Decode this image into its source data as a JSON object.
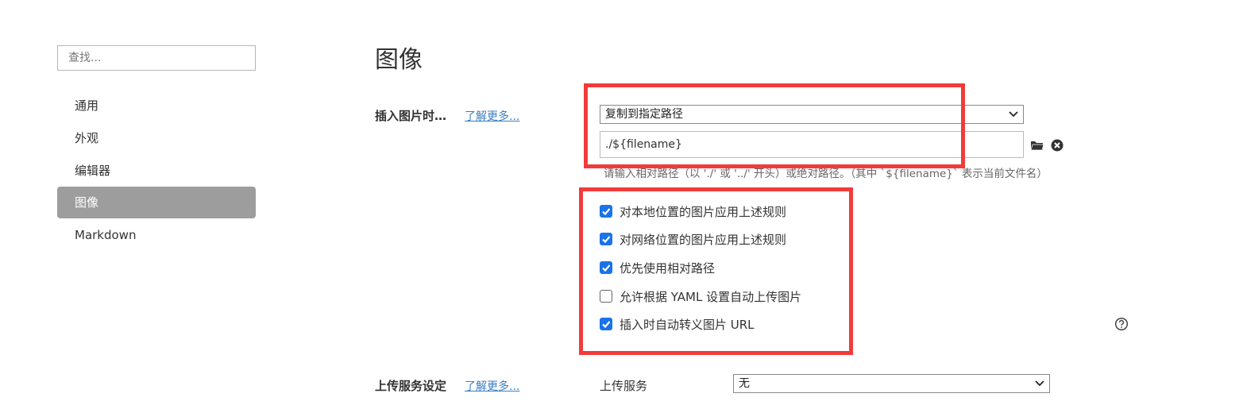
{
  "sidebar": {
    "search_placeholder": "查找...",
    "items": [
      {
        "label": "通用"
      },
      {
        "label": "外观"
      },
      {
        "label": "编辑器"
      },
      {
        "label": "图像",
        "active": true
      },
      {
        "label": "Markdown"
      }
    ]
  },
  "main": {
    "title": "图像",
    "insert_section": {
      "label": "插入图片时…",
      "learn_more": "了解更多...",
      "action_select": "复制到指定路径",
      "path_value": "./${filename}",
      "hint": "请输入相对路径（以 './' 或 '../' 开头）或绝对路径。（其中 `${filename}` 表示当前文件名）",
      "checkboxes": [
        {
          "label": "对本地位置的图片应用上述规则",
          "checked": true
        },
        {
          "label": "对网络位置的图片应用上述规则",
          "checked": true
        },
        {
          "label": "优先使用相对路径",
          "checked": true
        },
        {
          "label": "允许根据 YAML 设置自动上传图片",
          "checked": false
        },
        {
          "label": "插入时自动转义图片 URL",
          "checked": true
        }
      ]
    },
    "upload_section": {
      "label": "上传服务设定",
      "learn_more": "了解更多...",
      "service_label": "上传服务",
      "service_select": "无"
    }
  },
  "icons": {
    "folder": "folder-icon",
    "clear": "clear-icon",
    "help": "help-icon",
    "chevron": "chevron-down-icon"
  },
  "colors": {
    "accent": "#1a73e8",
    "active_nav_bg": "#9d9d9d",
    "link": "#3a7fc1",
    "highlight_box": "#f23b3b"
  }
}
